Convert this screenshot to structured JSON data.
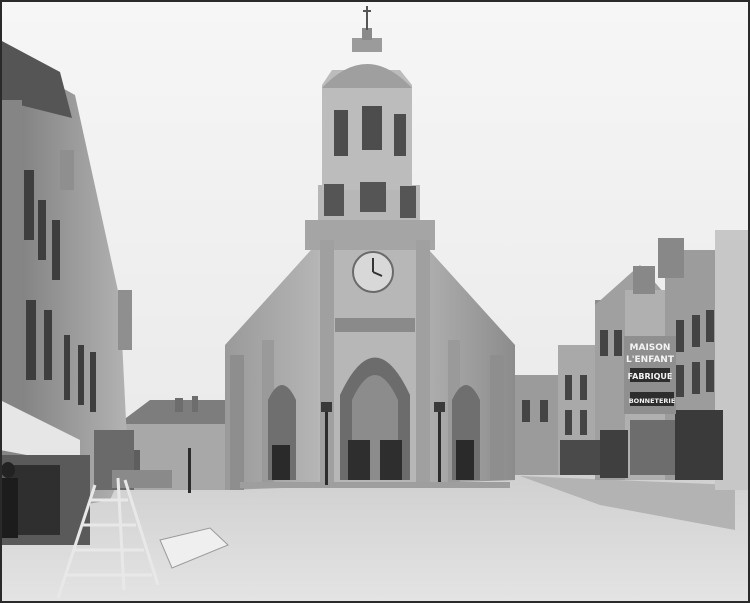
{
  "photo": {
    "sign": {
      "line1": "MAISON",
      "line2": "L'ENFANT",
      "line3": "FABRIQUE",
      "line4": "BONNETERIE"
    }
  },
  "colors": {
    "sky": "#f3f3f3",
    "stone": "#b9b9b9",
    "stone_dark": "#6f6f6f",
    "ground": "#d6d6d6",
    "shadow": "#3a3a3a"
  }
}
